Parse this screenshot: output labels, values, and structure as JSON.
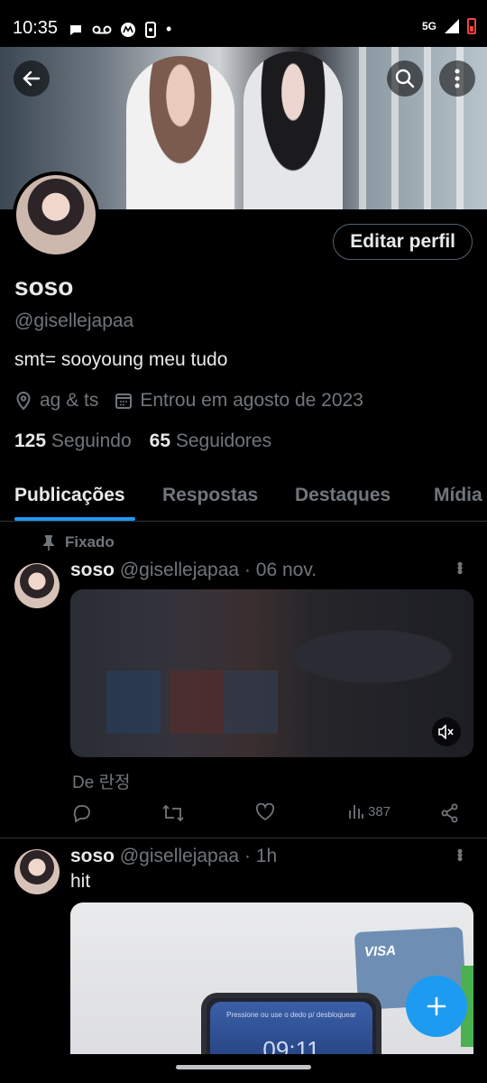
{
  "status_bar": {
    "time": "10:35",
    "network": "5G",
    "icons": [
      "chat-bubble-icon",
      "voicemail-icon",
      "motorola-icon",
      "phone-sync-icon",
      "dot-icon",
      "signal-icon",
      "battery-low-icon"
    ]
  },
  "header": {
    "back_icon": "arrow-left-icon",
    "search_icon": "search-icon",
    "more_icon": "more-vertical-icon"
  },
  "profile": {
    "edit_button": "Editar perfil",
    "display_name": "soso",
    "handle": "@gisellejapaa",
    "bio": "smt= sooyoung meu tudo",
    "location": "ag & ts",
    "joined": "Entrou em agosto de 2023",
    "following_count": "125",
    "following_label": "Seguindo",
    "followers_count": "65",
    "followers_label": "Seguidores"
  },
  "tabs": [
    {
      "label": "Publicações",
      "active": true
    },
    {
      "label": "Respostas",
      "active": false
    },
    {
      "label": "Destaques",
      "active": false
    },
    {
      "label": "Mídia",
      "active": false
    }
  ],
  "posts": [
    {
      "pinned_label": "Fixado",
      "name": "soso",
      "handle": "@gisellejapaa",
      "sep": "·",
      "time": "06 nov.",
      "caption": "De 란정",
      "views": "387"
    },
    {
      "name": "soso",
      "handle": "@gisellejapaa",
      "sep": "·",
      "time": "1h",
      "text": "hit",
      "media_phone_time": "09:11",
      "media_phone_hint": "Pressione ou use o dedo p/ desbloquear",
      "media_card_brand": "VISA"
    }
  ],
  "fab_icon": "plus-icon",
  "colors": {
    "accent": "#1d9bf0",
    "background": "#000000",
    "text_primary": "#e7e9ea",
    "text_secondary": "#71767b",
    "border": "#2f3336"
  }
}
